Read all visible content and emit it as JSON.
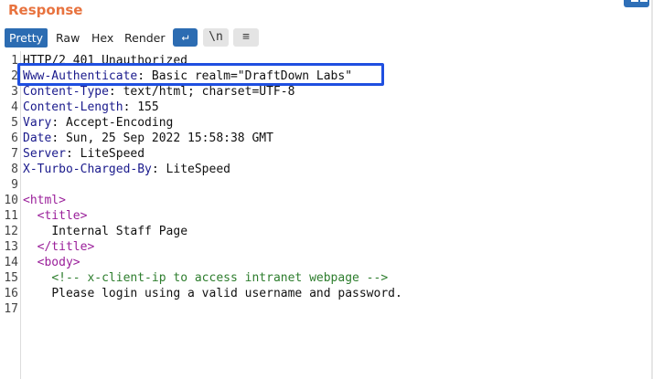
{
  "panel": {
    "title": "Response"
  },
  "toolbar": {
    "tabs": [
      "Pretty",
      "Raw",
      "Hex",
      "Render"
    ],
    "active_tab": "Pretty",
    "wrap_icon": "↵",
    "newline_label": "\\n",
    "menu_icon": "≡"
  },
  "editor": {
    "lines": [
      {
        "num": "1",
        "key": "",
        "text": "HTTP/2 401 Unauthorized"
      },
      {
        "num": "2",
        "key": "Www-Authenticate",
        "text": ": Basic realm=\"DraftDown Labs\""
      },
      {
        "num": "3",
        "key": "Content-Type",
        "text": ": text/html; charset=UTF-8"
      },
      {
        "num": "4",
        "key": "Content-Length",
        "text": ": 155"
      },
      {
        "num": "5",
        "key": "Vary",
        "text": ": Accept-Encoding"
      },
      {
        "num": "6",
        "key": "Date",
        "text": ": Sun, 25 Sep 2022 15:58:38 GMT"
      },
      {
        "num": "7",
        "key": "Server",
        "text": ": LiteSpeed"
      },
      {
        "num": "8",
        "key": "X-Turbo-Charged-By",
        "text": ": LiteSpeed"
      },
      {
        "num": "9",
        "key": "",
        "text": ""
      },
      {
        "num": "10",
        "tag": "<html>",
        "text": ""
      },
      {
        "num": "11",
        "indent": "  ",
        "tag": "<title>",
        "text": ""
      },
      {
        "num": "12",
        "indent": "    ",
        "tag": "",
        "text": "Internal Staff Page"
      },
      {
        "num": "13",
        "indent": "  ",
        "tag": "</title>",
        "text": ""
      },
      {
        "num": "14",
        "indent": "  ",
        "tag": "<body>",
        "text": ""
      },
      {
        "num": "15",
        "indent": "    ",
        "comment": "<!-- x-client-ip to access intranet webpage -->",
        "text": ""
      },
      {
        "num": "16",
        "indent": "    ",
        "tag": "",
        "text": "Please login using a valid username and password."
      },
      {
        "num": "17",
        "key": "",
        "text": ""
      }
    ]
  }
}
